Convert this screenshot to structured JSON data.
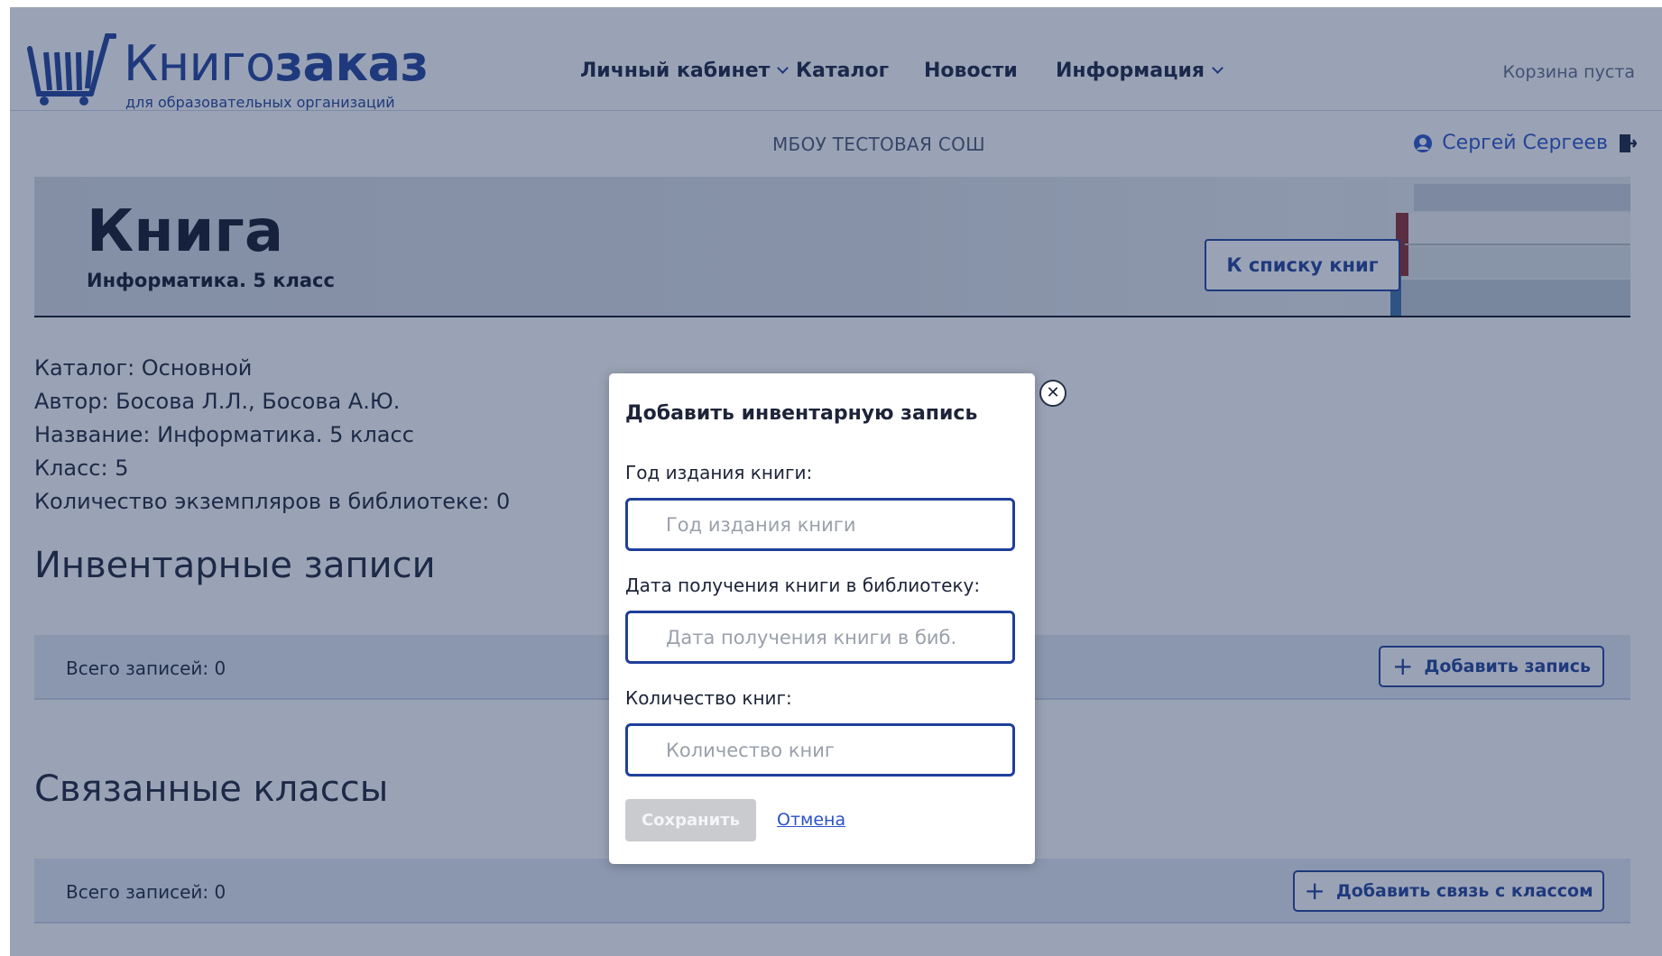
{
  "header": {
    "logo": {
      "word_light": "Книго",
      "word_bold": "заказ",
      "tagline": "для образовательных организаций"
    },
    "nav": [
      {
        "label": "Личный кабинет",
        "has_dropdown": true
      },
      {
        "label": "Каталог",
        "has_dropdown": false
      },
      {
        "label": "Новости",
        "has_dropdown": false
      },
      {
        "label": "Информация",
        "has_dropdown": true
      }
    ],
    "cart_status": "Корзина пуста"
  },
  "subheader": {
    "school": "МБОУ ТЕСТОВАЯ СОШ",
    "user_name": "Сергей Сергеев",
    "user_icon": "user-icon",
    "logout_icon": "logout-icon"
  },
  "hero": {
    "title": "Книга",
    "subtitle": "Информатика. 5 класс",
    "back_button": "К списку книг"
  },
  "book_info": {
    "catalog": "Каталог: Основной",
    "author": "Автор: Босова Л.Л., Босова А.Ю.",
    "name": "Название: Информатика. 5 класс",
    "grade": "Класс: 5",
    "copies": "Количество экземпляров в библиотеке: 0"
  },
  "inventory": {
    "heading": "Инвентарные записи",
    "total": "Всего записей: 0",
    "add_button": "Добавить запись"
  },
  "classes": {
    "heading": "Связанные классы",
    "total": "Всего записей: 0",
    "add_button": "Добавить связь с классом"
  },
  "modal": {
    "title": "Добавить инвентарную запись",
    "year_label": "Год издания книги:",
    "year_placeholder": "Год издания книги",
    "date_label": "Дата получения книги в библиотеку:",
    "date_placeholder": "Дата получения книги в биб.",
    "qty_label": "Количество книг:",
    "qty_placeholder": "Количество книг",
    "save_button": "Сохранить",
    "cancel_link": "Отмена",
    "close_icon": "close-icon"
  },
  "colors": {
    "brand_blue": "#1f3f9a",
    "link_blue": "#2a52c9",
    "panel_bg": "#e3eaf5",
    "overlay": "rgba(32,50,92,0.45)",
    "disabled_button": "#c9cbcf"
  }
}
